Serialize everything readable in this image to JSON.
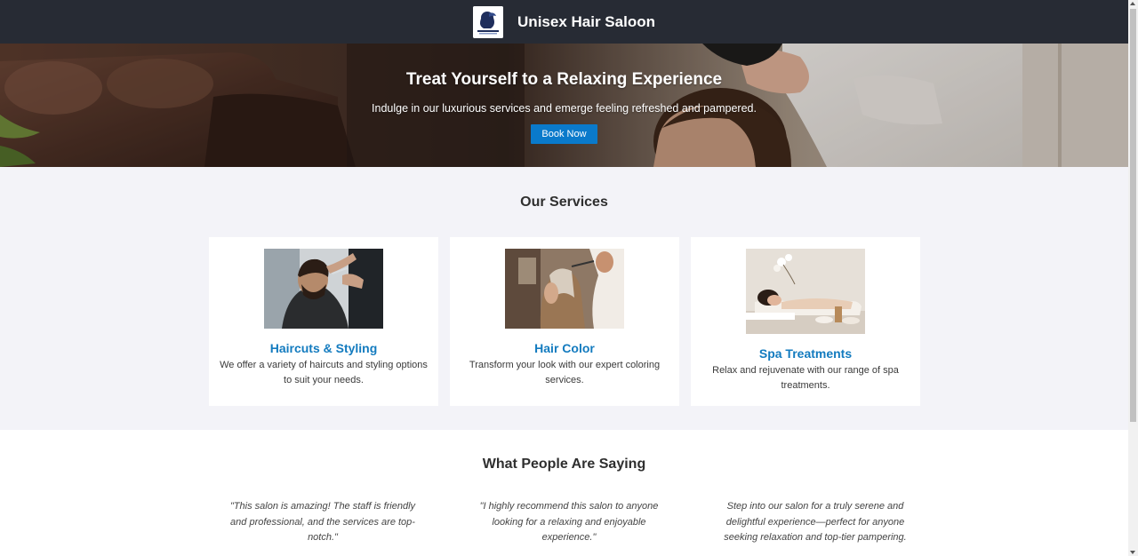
{
  "header": {
    "title": "Unisex Hair Saloon",
    "logo_text": "Unisex HAIR SALON"
  },
  "hero": {
    "title": "Treat Yourself to a Relaxing Experience",
    "subtitle": "Indulge in our luxurious services and emerge feeling refreshed and pampered.",
    "cta_label": "Book Now",
    "cta_color": "#0a7acb"
  },
  "services": {
    "title": "Our Services",
    "items": [
      {
        "title": "Haircuts & Styling",
        "description": "We offer a variety of haircuts and styling options to suit your needs.",
        "image": "barber-cutting-hair-photo"
      },
      {
        "title": "Hair Color",
        "description": "Transform your look with our expert coloring services.",
        "image": "hair-coloring-photo"
      },
      {
        "title": "Spa Treatments",
        "description": "Relax and rejuvenate with our range of spa treatments.",
        "image": "spa-treatment-photo"
      }
    ]
  },
  "testimonials": {
    "title": "What People Are Saying",
    "items": [
      {
        "text": "\"This salon is amazing! The staff is friendly and professional, and the services are top-notch.\""
      },
      {
        "text": "\"I highly recommend this salon to anyone looking for a relaxing and enjoyable experience.\""
      },
      {
        "text": "Step into our salon for a truly serene and delightful experience—perfect for anyone seeking relaxation and top-tier pampering."
      }
    ]
  },
  "colors": {
    "header_bg": "#272b34",
    "accent": "#137bbf",
    "services_bg": "#f3f3f8"
  }
}
